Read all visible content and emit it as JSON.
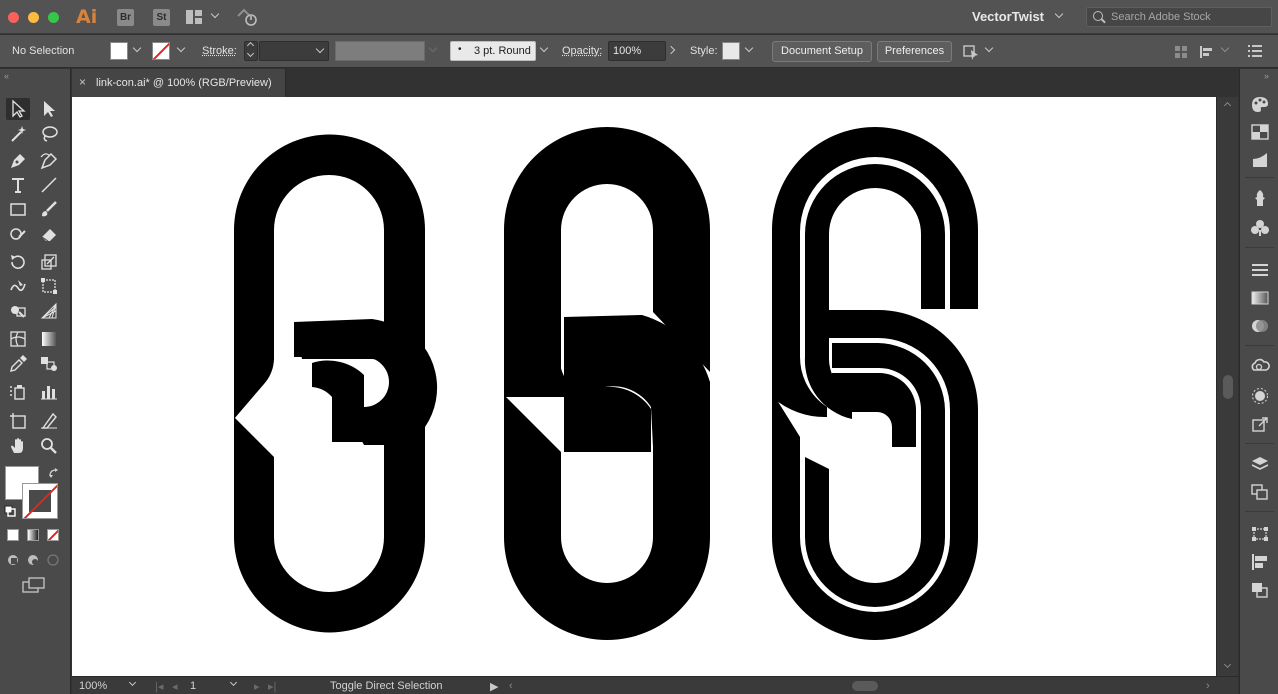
{
  "window": {
    "app_logo": "Ai",
    "bridge_badge": "Br",
    "stock_badge": "St",
    "workspace_name": "VectorTwist",
    "search_placeholder": "Search Adobe Stock"
  },
  "control_bar": {
    "selection_status": "No Selection",
    "stroke_label": "Stroke:",
    "brush_value": "3 pt. Round",
    "opacity_label": "Opacity:",
    "opacity_value": "100%",
    "style_label": "Style:",
    "document_setup_label": "Document Setup",
    "preferences_label": "Preferences"
  },
  "document_tab": {
    "close_glyph": "×",
    "title": "link-con.ai* @ 100% (RGB/Preview)"
  },
  "status_bar": {
    "zoom_value": "100%",
    "artboard_value": "1",
    "status_text": "Toggle Direct Selection"
  },
  "colors": {
    "chrome": "#535353",
    "panel": "#4a4a4a",
    "canvas": "#ffffff",
    "artwork": "#000000",
    "accent_red": "#e0261f",
    "ai_logo": "#d7833b"
  },
  "tools": [
    "selection-tool",
    "direct-selection-tool",
    "magic-wand-tool",
    "lasso-tool",
    "pen-tool",
    "curvature-tool",
    "type-tool",
    "line-segment-tool",
    "rectangle-tool",
    "paintbrush-tool",
    "shaper-tool",
    "eraser-tool",
    "rotate-tool",
    "scale-tool",
    "warp-tool",
    "free-transform-tool",
    "shape-builder-tool",
    "perspective-grid-tool",
    "mesh-tool",
    "gradient-tool",
    "eyedropper-tool",
    "blend-tool",
    "symbol-sprayer-tool",
    "column-graph-tool",
    "artboard-tool",
    "slice-tool",
    "hand-tool",
    "zoom-tool"
  ],
  "right_dock_icons": [
    "color-guide-icon",
    "swatches-icon",
    "brushes-icon",
    "symbols-icon",
    "graphic-styles-icon",
    "stroke-icon",
    "gradient-icon",
    "transparency-icon",
    "cc-libraries-icon",
    "appearance-icon",
    "asset-export-icon",
    "layers-icon",
    "artboards-icon",
    "transform-icon",
    "align-icon",
    "pathfinder-icon"
  ]
}
